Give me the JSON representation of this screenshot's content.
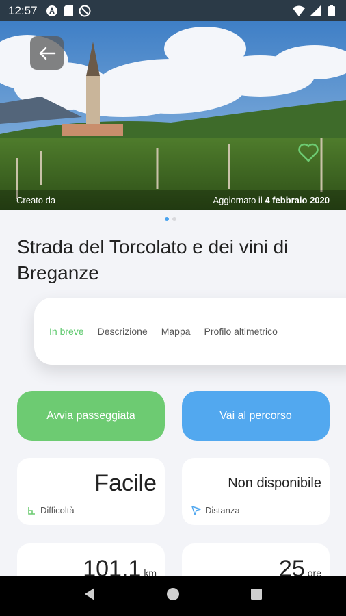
{
  "status": {
    "time": "12:57"
  },
  "hero": {
    "created_by_label": "Creato da",
    "updated_prefix": "Aggiornato il",
    "updated_date": "4 febbraio 2020"
  },
  "title": "Strada del Torcolato e dei vini di Breganze",
  "tabs": [
    {
      "label": "In breve",
      "active": true
    },
    {
      "label": "Descrizione",
      "active": false
    },
    {
      "label": "Mappa",
      "active": false
    },
    {
      "label": "Profilo altimetrico",
      "active": false
    }
  ],
  "actions": {
    "walk_label": "Avvia passeggiata",
    "route_label": "Vai al percorso"
  },
  "stats": {
    "difficulty_value": "Facile",
    "difficulty_label": "Difficoltà",
    "distance_value": "Non disponibile",
    "distance_label": "Distanza",
    "length_value": "101,1",
    "length_unit": "km",
    "duration_value": "25",
    "duration_unit": "ore"
  },
  "colors": {
    "accent_green": "#6dcb72",
    "accent_blue": "#52a8ef",
    "status_bar": "#2b3a47"
  }
}
